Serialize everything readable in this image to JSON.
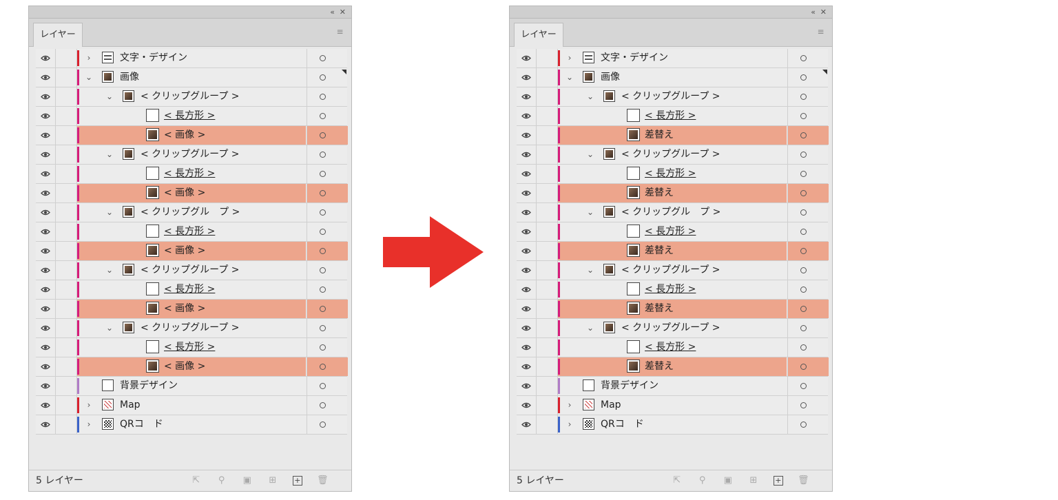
{
  "panels": [
    {
      "tab_label": "レイヤー",
      "footer_count": "5 レイヤー",
      "rows": [
        {
          "depth": 0,
          "chev": "›",
          "label": "文字・デザイン",
          "bar": "#d8202e",
          "thumb": "doc",
          "u": false,
          "hl": false,
          "sel": false
        },
        {
          "depth": 0,
          "chev": "⌄",
          "label": "画像",
          "bar": "#d61c7a",
          "thumb": "img",
          "u": false,
          "hl": false,
          "sel": true
        },
        {
          "depth": 1,
          "chev": "⌄",
          "label": "< クリップグループ >",
          "bar": "#d61c7a",
          "thumb": "img",
          "u": false,
          "hl": false,
          "sel": false
        },
        {
          "depth": 2,
          "chev": "",
          "label": "< 長方形 >",
          "bar": "#d61c7a",
          "thumb": "blank",
          "u": true,
          "hl": false,
          "sel": false
        },
        {
          "depth": 2,
          "chev": "",
          "label": "< 画像 >",
          "bar": "#d61c7a",
          "thumb": "img",
          "u": false,
          "hl": true,
          "sel": false
        },
        {
          "depth": 1,
          "chev": "⌄",
          "label": "< クリップグループ >",
          "bar": "#d61c7a",
          "thumb": "img",
          "u": false,
          "hl": false,
          "sel": false
        },
        {
          "depth": 2,
          "chev": "",
          "label": "< 長方形 >",
          "bar": "#d61c7a",
          "thumb": "blank",
          "u": true,
          "hl": false,
          "sel": false
        },
        {
          "depth": 2,
          "chev": "",
          "label": "< 画像 >",
          "bar": "#d61c7a",
          "thumb": "img",
          "u": false,
          "hl": true,
          "sel": false
        },
        {
          "depth": 1,
          "chev": "⌄",
          "label": "< クリップグル　プ >",
          "bar": "#d61c7a",
          "thumb": "img",
          "u": false,
          "hl": false,
          "sel": false
        },
        {
          "depth": 2,
          "chev": "",
          "label": "< 長方形 >",
          "bar": "#d61c7a",
          "thumb": "blank",
          "u": true,
          "hl": false,
          "sel": false
        },
        {
          "depth": 2,
          "chev": "",
          "label": "< 画像 >",
          "bar": "#d61c7a",
          "thumb": "img",
          "u": false,
          "hl": true,
          "sel": false
        },
        {
          "depth": 1,
          "chev": "⌄",
          "label": "< クリップグループ >",
          "bar": "#d61c7a",
          "thumb": "img",
          "u": false,
          "hl": false,
          "sel": false
        },
        {
          "depth": 2,
          "chev": "",
          "label": "< 長方形 >",
          "bar": "#d61c7a",
          "thumb": "blank",
          "u": true,
          "hl": false,
          "sel": false
        },
        {
          "depth": 2,
          "chev": "",
          "label": "< 画像 >",
          "bar": "#d61c7a",
          "thumb": "img",
          "u": false,
          "hl": true,
          "sel": false
        },
        {
          "depth": 1,
          "chev": "⌄",
          "label": "< クリップグループ >",
          "bar": "#d61c7a",
          "thumb": "img",
          "u": false,
          "hl": false,
          "sel": false
        },
        {
          "depth": 2,
          "chev": "",
          "label": "< 長方形 >",
          "bar": "#d61c7a",
          "thumb": "blank",
          "u": true,
          "hl": false,
          "sel": false
        },
        {
          "depth": 2,
          "chev": "",
          "label": "< 画像 >",
          "bar": "#d61c7a",
          "thumb": "img",
          "u": false,
          "hl": true,
          "sel": false
        },
        {
          "depth": 0,
          "chev": "",
          "label": "背景デザイン",
          "bar": "#b07cc6",
          "thumb": "blank",
          "u": false,
          "hl": false,
          "sel": false
        },
        {
          "depth": 0,
          "chev": "›",
          "label": "Map",
          "bar": "#d8202e",
          "thumb": "map",
          "u": false,
          "hl": false,
          "sel": false
        },
        {
          "depth": 0,
          "chev": "›",
          "label": "QRコ　ド",
          "bar": "#3a62c8",
          "thumb": "qr",
          "u": false,
          "hl": false,
          "sel": false
        }
      ]
    },
    {
      "tab_label": "レイヤー",
      "footer_count": "5 レイヤー",
      "rows": [
        {
          "depth": 0,
          "chev": "›",
          "label": "文字・デザイン",
          "bar": "#d8202e",
          "thumb": "doc",
          "u": false,
          "hl": false,
          "sel": false
        },
        {
          "depth": 0,
          "chev": "⌄",
          "label": "画像",
          "bar": "#d61c7a",
          "thumb": "img",
          "u": false,
          "hl": false,
          "sel": true
        },
        {
          "depth": 1,
          "chev": "⌄",
          "label": "< クリップグループ >",
          "bar": "#d61c7a",
          "thumb": "img",
          "u": false,
          "hl": false,
          "sel": false
        },
        {
          "depth": 2,
          "chev": "",
          "label": "< 長方形 >",
          "bar": "#d61c7a",
          "thumb": "blank",
          "u": true,
          "hl": false,
          "sel": false
        },
        {
          "depth": 2,
          "chev": "",
          "label": "差替え",
          "bar": "#d61c7a",
          "thumb": "img",
          "u": false,
          "hl": true,
          "sel": false
        },
        {
          "depth": 1,
          "chev": "⌄",
          "label": "< クリップグループ >",
          "bar": "#d61c7a",
          "thumb": "img",
          "u": false,
          "hl": false,
          "sel": false
        },
        {
          "depth": 2,
          "chev": "",
          "label": "< 長方形 >",
          "bar": "#d61c7a",
          "thumb": "blank",
          "u": true,
          "hl": false,
          "sel": false
        },
        {
          "depth": 2,
          "chev": "",
          "label": "差替え",
          "bar": "#d61c7a",
          "thumb": "img",
          "u": false,
          "hl": true,
          "sel": false
        },
        {
          "depth": 1,
          "chev": "⌄",
          "label": "< クリップグル　プ >",
          "bar": "#d61c7a",
          "thumb": "img",
          "u": false,
          "hl": false,
          "sel": false
        },
        {
          "depth": 2,
          "chev": "",
          "label": "< 長方形 >",
          "bar": "#d61c7a",
          "thumb": "blank",
          "u": true,
          "hl": false,
          "sel": false
        },
        {
          "depth": 2,
          "chev": "",
          "label": "差替え",
          "bar": "#d61c7a",
          "thumb": "img",
          "u": false,
          "hl": true,
          "sel": false
        },
        {
          "depth": 1,
          "chev": "⌄",
          "label": "< クリップグループ >",
          "bar": "#d61c7a",
          "thumb": "img",
          "u": false,
          "hl": false,
          "sel": false
        },
        {
          "depth": 2,
          "chev": "",
          "label": "< 長方形 >",
          "bar": "#d61c7a",
          "thumb": "blank",
          "u": true,
          "hl": false,
          "sel": false
        },
        {
          "depth": 2,
          "chev": "",
          "label": "差替え",
          "bar": "#d61c7a",
          "thumb": "img",
          "u": false,
          "hl": true,
          "sel": false
        },
        {
          "depth": 1,
          "chev": "⌄",
          "label": "< クリップグループ >",
          "bar": "#d61c7a",
          "thumb": "img",
          "u": false,
          "hl": false,
          "sel": false
        },
        {
          "depth": 2,
          "chev": "",
          "label": "< 長方形 >",
          "bar": "#d61c7a",
          "thumb": "blank",
          "u": true,
          "hl": false,
          "sel": false
        },
        {
          "depth": 2,
          "chev": "",
          "label": "差替え",
          "bar": "#d61c7a",
          "thumb": "img",
          "u": false,
          "hl": true,
          "sel": false
        },
        {
          "depth": 0,
          "chev": "",
          "label": "背景デザイン",
          "bar": "#b07cc6",
          "thumb": "blank",
          "u": false,
          "hl": false,
          "sel": false
        },
        {
          "depth": 0,
          "chev": "›",
          "label": "Map",
          "bar": "#d8202e",
          "thumb": "map",
          "u": false,
          "hl": false,
          "sel": false
        },
        {
          "depth": 0,
          "chev": "›",
          "label": "QRコ　ド",
          "bar": "#3a62c8",
          "thumb": "qr",
          "u": false,
          "hl": false,
          "sel": false
        }
      ]
    }
  ],
  "colors": {
    "highlight": "#eda58c",
    "arrow": "#e8302a"
  }
}
